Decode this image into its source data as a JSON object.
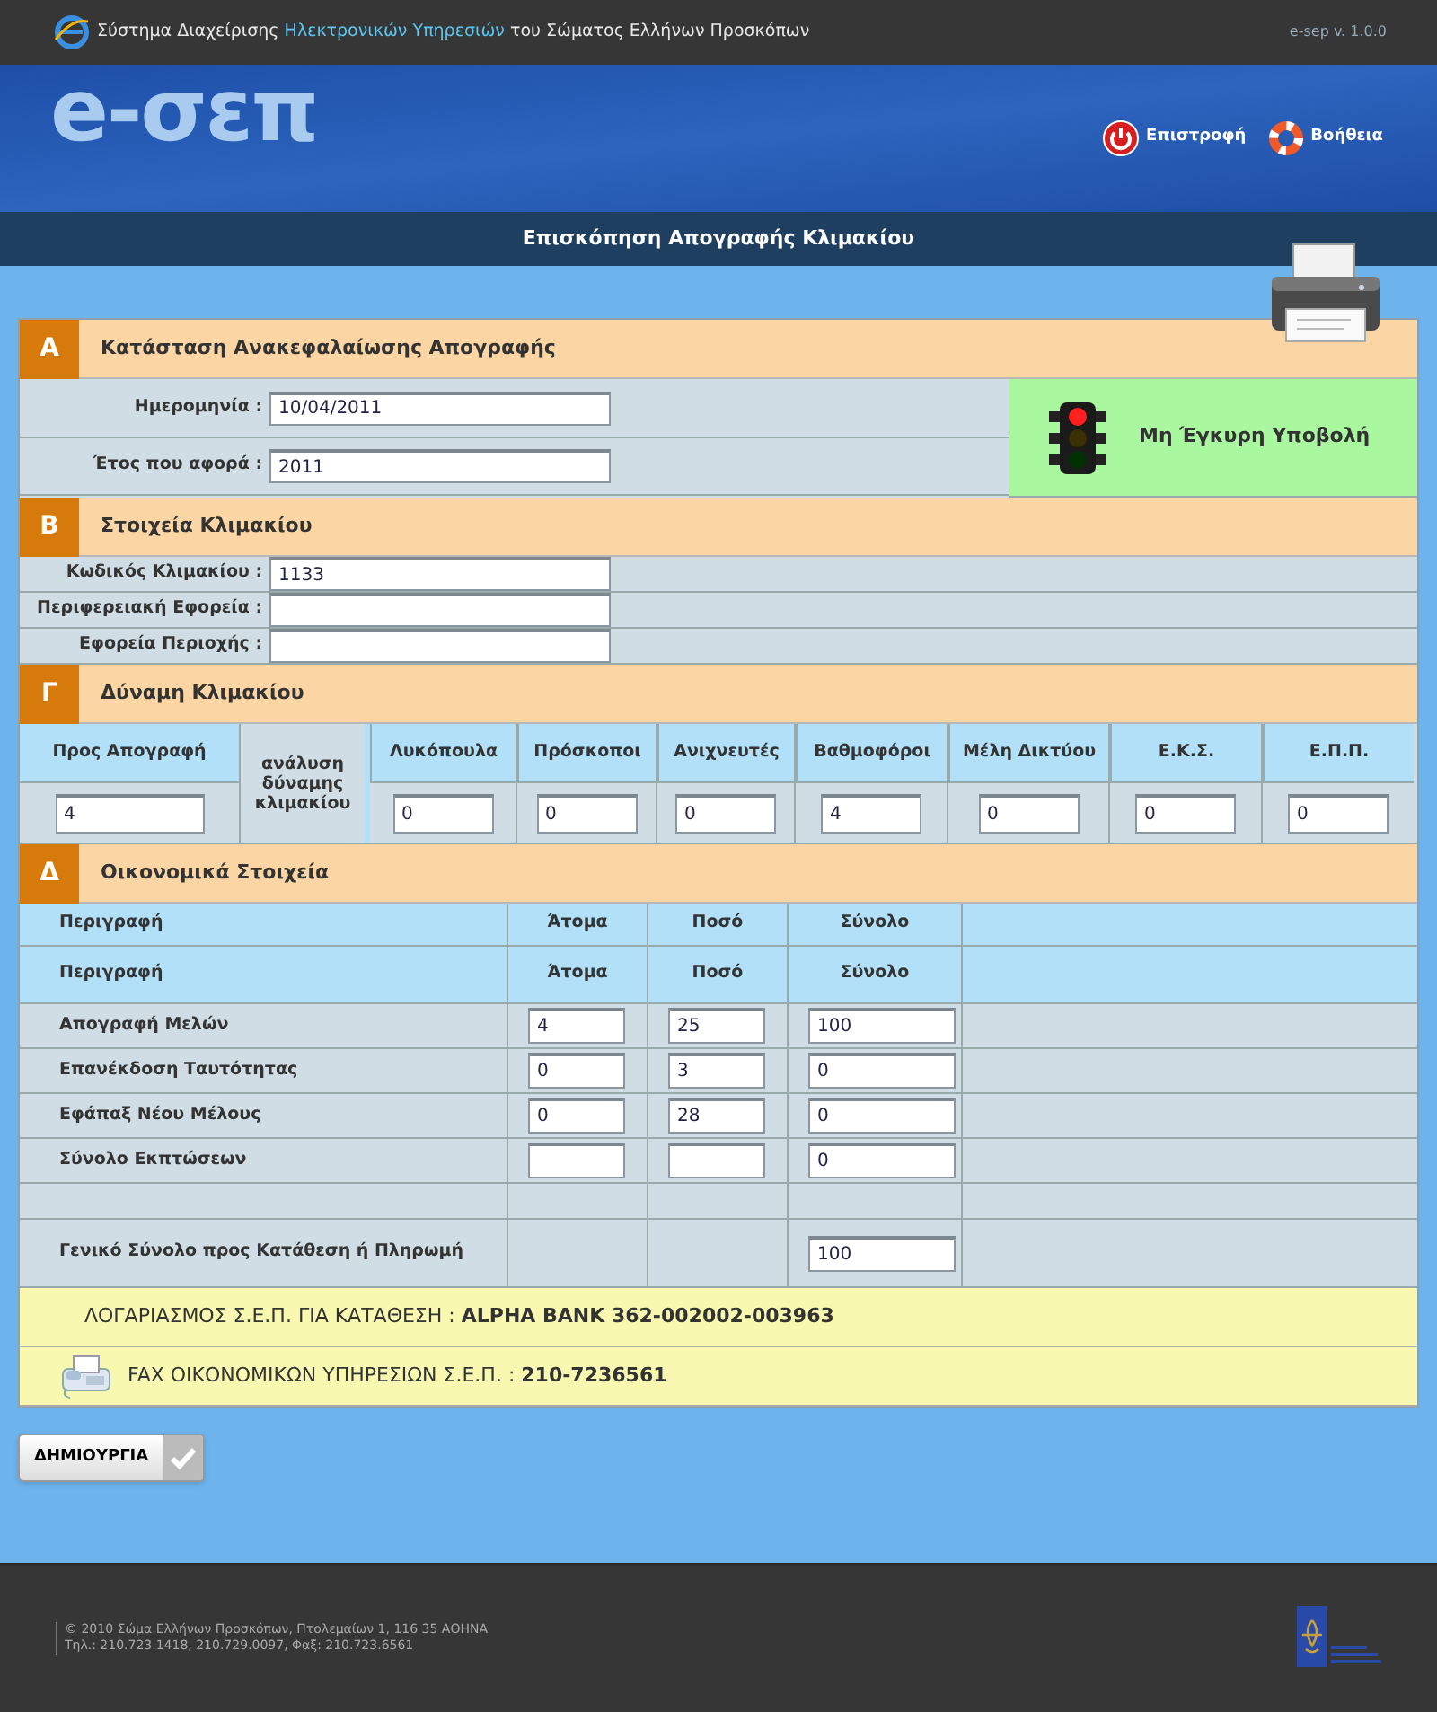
{
  "top_bar": {
    "system_title": "Σύστημα Διαχείρισης **Ηλεκτρονικών Υπηρεσιών** του Σώματος Ελλήνων Προσκόπων",
    "version": "e-sep v. 1.0.0"
  },
  "banner": {
    "logo": "e-σεπ",
    "links": [
      {
        "kind": "power",
        "label": "Επιστροφή"
      },
      {
        "kind": "help",
        "label": "Βοήθεια"
      }
    ]
  },
  "page_title": "Επισκόπηση Απογραφής Κλιμακίου",
  "section_a": {
    "letter": "Α",
    "title": "Κατάσταση Ανακεφαλαίωσης Απογραφής",
    "fields": [
      {
        "label": "Ημερομηνία :",
        "value": "10/04/2011"
      },
      {
        "label": "Έτος που αφορά :",
        "value": "2011"
      }
    ],
    "status": {
      "lamps": [
        {
          "on": true
        },
        {
          "on": false
        },
        {
          "on": false
        }
      ],
      "label": "Μη Έγκυρη Υποβολή"
    }
  },
  "section_b": {
    "letter": "Β",
    "title": "Στοιχεία Κλιμακίου",
    "fields": [
      {
        "label": "Κωδικός Κλιμακίου :",
        "value": "1133"
      },
      {
        "label": "Περιφερειακή Εφορεία :"
      },
      {
        "label": "Εφορεία Περιοχής :"
      }
    ]
  },
  "section_c": {
    "letter": "Γ",
    "title": "Δύναμη Κλιμακίου",
    "census": {
      "label": "Προς Απογραφή",
      "value": "4"
    },
    "breakdown_label": "ανάλυση δύναμης κλιμακίου",
    "columns": [
      {
        "label": "Λυκόπουλα",
        "value": "0"
      },
      {
        "label": "Πρόσκοποι",
        "value": "0"
      },
      {
        "label": "Ανιχνευτές",
        "value": "0"
      },
      {
        "label": "Βαθμοφόροι",
        "value": "4"
      },
      {
        "label": "Μέλη Δικτύου",
        "value": "0"
      },
      {
        "label": "Ε.Κ.Σ.",
        "value": "0"
      },
      {
        "label": "Ε.Π.Π.",
        "value": "0"
      }
    ]
  },
  "section_d": {
    "letter": "Δ",
    "title": "Οικονομικά Στοιχεία",
    "header_rows": [
      [
        "Περιγραφή",
        "Άτομα",
        "Ποσό",
        "Σύνολο"
      ],
      [
        "Περιγραφή",
        "Άτομα",
        "Ποσό",
        "Σύνολο"
      ]
    ],
    "rows": [
      {
        "kind": "data",
        "label": "Απογραφή Μελών",
        "cells": [
          {
            "kind": "field",
            "value": "4"
          },
          {
            "kind": "field",
            "value": "25"
          },
          {
            "kind": "field",
            "value": "100"
          }
        ]
      },
      {
        "kind": "data",
        "label": "Επανέκδοση Ταυτότητας",
        "cells": [
          {
            "kind": "field",
            "value": "0"
          },
          {
            "kind": "field",
            "value": "3"
          },
          {
            "kind": "field",
            "value": "0"
          }
        ]
      },
      {
        "kind": "data",
        "label": "Εφάπαξ Νέου Μέλους",
        "cells": [
          {
            "kind": "field",
            "value": "0"
          },
          {
            "kind": "field",
            "value": "28"
          },
          {
            "kind": "field",
            "value": "0"
          }
        ]
      },
      {
        "kind": "data",
        "label": "Σύνολο Εκπτώσεων",
        "cells": [
          {
            "kind": "field"
          },
          {
            "kind": "field"
          },
          {
            "kind": "field",
            "value": "0"
          }
        ]
      },
      {
        "kind": "spacer"
      },
      {
        "kind": "total",
        "label": "Γενικό Σύνολο προς Κατάθεση ή Πληρωμή",
        "cells": [
          {
            "kind": "blank"
          },
          {
            "kind": "blank"
          },
          {
            "kind": "field",
            "value": "100"
          }
        ]
      }
    ]
  },
  "notices": [
    {
      "kind": "account",
      "text": "ΛΟΓΑΡΙΑΣΜΟΣ Σ.Ε.Π. ΓΙΑ ΚΑΤΑΘΕΣΗ : **ALPHA BANK 362-002002-003963**"
    },
    {
      "kind": "fax",
      "text": "FAX ΟΙΚΟΝΟΜΙΚΩΝ ΥΠΗΡΕΣΙΩΝ Σ.Ε.Π. : **210-7236561**"
    }
  ],
  "create_button": "ΔΗΜΙΟΥΡΓΙΑ",
  "footer": [
    "© 2010 Σώμα Ελλήνων Προσκόπων, Πτολεμαίων 1, 116 35 ΑΘΗΝΑ",
    "Τηλ.: 210.723.1418, 210.729.0097, Φαξ: 210.723.6561"
  ]
}
